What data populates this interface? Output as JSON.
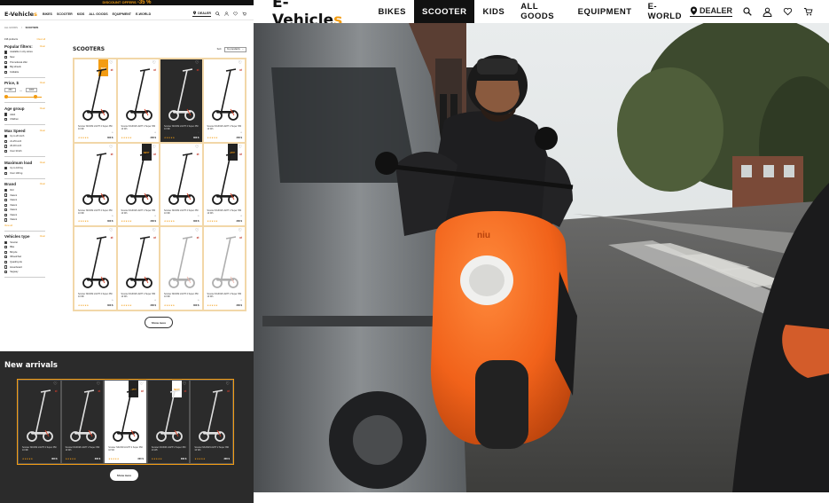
{
  "banner": {
    "text": "DISCOUNT OFFERS",
    "percent": "-35 %"
  },
  "small_header": {
    "logo": "E-Vehicle",
    "logo_accent": "s",
    "nav": [
      "BIKES",
      "SCOOTER",
      "KIDS",
      "ALL GOODS",
      "EQUIPMENT",
      "E-WORLD"
    ],
    "dealer": "DEALER"
  },
  "breadcrumb": {
    "root": "ALL GOODS",
    "current": "SCOOTERS"
  },
  "filters": {
    "count": "196 products",
    "clear_all": "Clear all",
    "clear": "Clear",
    "popular": {
      "title": "Popular filters:",
      "options": [
        {
          "label": "Available in city stores",
          "checked": true
        },
        {
          "label": "New",
          "checked": false
        },
        {
          "label": "Promotional offer",
          "checked": false
        },
        {
          "label": "Big wheels",
          "checked": true
        },
        {
          "label": "Foldable",
          "checked": false
        }
      ]
    },
    "price": {
      "title": "Price, $",
      "min": "250",
      "max": "2300"
    },
    "age": {
      "title": "Age group",
      "options": [
        {
          "label": "Adult",
          "checked": true
        },
        {
          "label": "Children",
          "checked": false
        }
      ]
    },
    "speed": {
      "title": "Max Speed",
      "options": [
        {
          "label": "Up to 20 km/h",
          "checked": true
        },
        {
          "label": "21-25 km/h",
          "checked": false
        },
        {
          "label": "26-30 km/h",
          "checked": false
        },
        {
          "label": "Over 30 k/h",
          "checked": false
        }
      ]
    },
    "load": {
      "title": "Maximum load",
      "options": [
        {
          "label": "Up to 100 kg",
          "checked": true
        },
        {
          "label": "Over 100 kg",
          "checked": false
        }
      ]
    },
    "brand": {
      "title": "Brand",
      "options": [
        {
          "label": "NIU",
          "checked": true
        },
        {
          "label": "Xiaomi",
          "checked": false
        },
        {
          "label": "Xiaomi",
          "checked": false
        },
        {
          "label": "Xiaomi",
          "checked": false
        },
        {
          "label": "Xiaomi",
          "checked": false
        },
        {
          "label": "Xiaomi",
          "checked": false
        },
        {
          "label": "Xiaomi",
          "checked": false
        }
      ],
      "view_all": "View all"
    },
    "vehicles": {
      "title": "Vehicles type",
      "options": [
        {
          "label": "Scooter",
          "checked": true
        },
        {
          "label": "Bike",
          "checked": false
        },
        {
          "label": "Bicycle",
          "checked": false
        },
        {
          "label": "Wheelchair",
          "checked": false
        },
        {
          "label": "Quadricycle",
          "checked": false
        },
        {
          "label": "Hoverboard",
          "checked": false
        },
        {
          "label": "Segway",
          "checked": false
        }
      ]
    }
  },
  "catalog": {
    "title": "SCOOTERS",
    "sort_label": "Sort:",
    "sort_value": "by popularity",
    "product_name": "Scooter NIUKIM LIGHT 2 Super 350 10 Wh",
    "price": "300 $",
    "stars": "★★★★★",
    "tiles": [
      {
        "tag": "TOP",
        "dark": false,
        "faded": false
      },
      {
        "tag": "",
        "dark": false,
        "faded": false
      },
      {
        "tag": "",
        "dark": true,
        "faded": false
      },
      {
        "tag": "",
        "dark": false,
        "faded": false
      },
      {
        "tag": "",
        "dark": false,
        "faded": false
      },
      {
        "tag": "NEW",
        "dark": false,
        "faded": false
      },
      {
        "tag": "",
        "dark": false,
        "faded": false
      },
      {
        "tag": "-15%",
        "dark": false,
        "faded": false
      },
      {
        "tag": "",
        "dark": false,
        "faded": false
      },
      {
        "tag": "",
        "dark": false,
        "faded": false
      },
      {
        "tag": "",
        "dark": false,
        "faded": true
      },
      {
        "tag": "",
        "dark": false,
        "faded": true
      }
    ],
    "show_more": "Show more"
  },
  "arrivals": {
    "title": "New arrivals",
    "tiles": [
      {
        "tag": "",
        "light": false
      },
      {
        "tag": "",
        "light": false
      },
      {
        "tag": "-15%",
        "light": true
      },
      {
        "tag": "NEW",
        "light": false
      },
      {
        "tag": "",
        "light": false
      }
    ],
    "show_more": "Show more"
  },
  "big_header": {
    "logo": "E-Vehicle",
    "logo_accent": "s",
    "nav": [
      "BIKES",
      "SCOOTER",
      "KIDS",
      "ALL GOODS",
      "EQUIPMENT",
      "E-WORLD"
    ],
    "active": 1,
    "dealer": "DEALER",
    "icons": [
      "search-icon",
      "user-icon",
      "heart-icon",
      "cart-icon"
    ]
  },
  "hero": {
    "scooter_brand": "niu"
  },
  "colors": {
    "accent": "#f39c12",
    "dark": "#111111",
    "panel": "#2b2b2b"
  }
}
